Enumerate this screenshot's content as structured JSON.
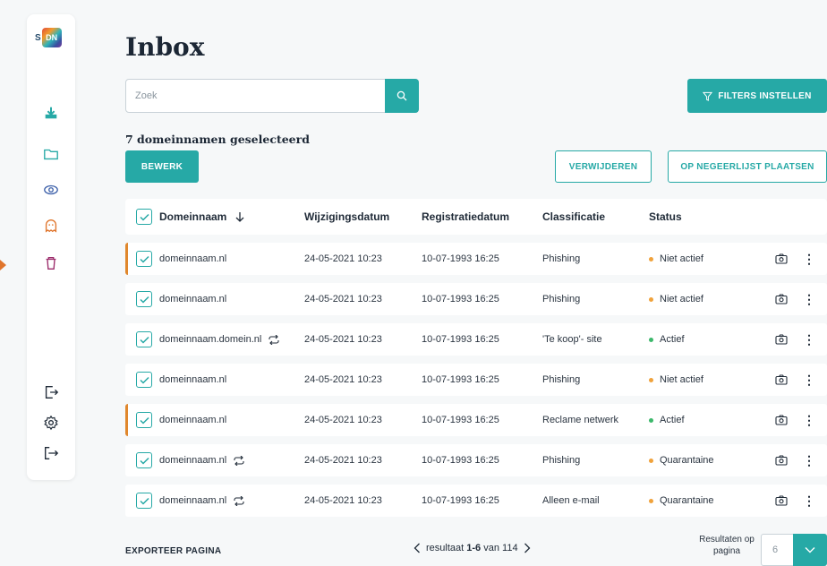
{
  "colors": {
    "accent": "#26a9a6",
    "flag": "#e0872c",
    "status_inactive": "#f0a23b",
    "status_active": "#3cb86b",
    "status_quarantine": "#f0a23b"
  },
  "logo": {
    "text": "S DN"
  },
  "sidebar": {
    "icons": [
      "download-icon",
      "folder-icon",
      "eye-icon",
      "ghost-icon",
      "trash-icon",
      "login-icon",
      "settings-icon",
      "logout-icon"
    ]
  },
  "page": {
    "title": "Inbox"
  },
  "search": {
    "placeholder": "Zoek"
  },
  "toolbar": {
    "filters_label": "FILTERS INSTELLEN",
    "selected_count": "7 domeinnamen geselecteerd",
    "edit_label": "BEWERK",
    "delete_label": "VERWIJDEREN",
    "ignore_label": "OP NEGEERLIJST PLAATSEN"
  },
  "table": {
    "headers": {
      "domain": "Domeinnaam",
      "modified": "Wijzigingsdatum",
      "registered": "Registratiedatum",
      "classification": "Classificatie",
      "status": "Status"
    },
    "rows": [
      {
        "domain": "domeinnaam.nl",
        "sync": false,
        "flag": true,
        "modified": "24-05-2021 10:23",
        "registered": "10-07-1993 16:25",
        "classification": "Phishing",
        "status": "Niet actief",
        "status_type": "inactive"
      },
      {
        "domain": "domeinnaam.nl",
        "sync": false,
        "flag": false,
        "modified": "24-05-2021 10:23",
        "registered": "10-07-1993 16:25",
        "classification": "Phishing",
        "status": "Niet actief",
        "status_type": "inactive"
      },
      {
        "domain": "domeinnaam.domein.nl",
        "sync": true,
        "flag": false,
        "modified": "24-05-2021 10:23",
        "registered": "10-07-1993 16:25",
        "classification": "'Te koop'- site",
        "status": "Actief",
        "status_type": "active"
      },
      {
        "domain": "domeinnaam.nl",
        "sync": false,
        "flag": false,
        "modified": "24-05-2021 10:23",
        "registered": "10-07-1993 16:25",
        "classification": "Phishing",
        "status": "Niet actief",
        "status_type": "inactive"
      },
      {
        "domain": "domeinnaam.nl",
        "sync": false,
        "flag": true,
        "modified": "24-05-2021 10:23",
        "registered": "10-07-1993 16:25",
        "classification": "Reclame netwerk",
        "status": "Actief",
        "status_type": "active"
      },
      {
        "domain": "domeinnaam.nl",
        "sync": true,
        "flag": false,
        "modified": "24-05-2021 10:23",
        "registered": "10-07-1993 16:25",
        "classification": "Phishing",
        "status": "Quarantaine",
        "status_type": "quarantine"
      },
      {
        "domain": "domeinnaam.nl",
        "sync": true,
        "flag": false,
        "modified": "24-05-2021 10:23",
        "registered": "10-07-1993 16:25",
        "classification": "Alleen e-mail",
        "status": "Quarantaine",
        "status_type": "quarantine"
      }
    ]
  },
  "footer": {
    "export_label": "EXPORTEER PAGINA",
    "pagination_prefix": "resultaat",
    "pagination_range": "1-6",
    "pagination_suffix": "van 114",
    "per_page_label": "Resultaten op pagina",
    "per_page_value": "6"
  }
}
